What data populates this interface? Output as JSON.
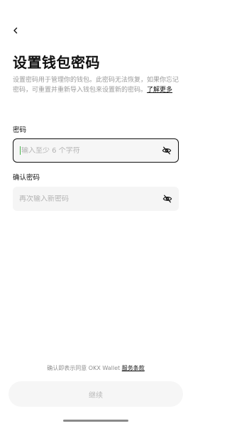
{
  "header": {
    "title": "设置钱包密码",
    "description": "设置密码用于管理你的钱包。此密码无法恢复，如果你忘记密码，可重置并重新导入钱包来设置新的密码。",
    "learn_more": "了解更多"
  },
  "form": {
    "password_label": "密码",
    "password_placeholder": "输入至少 6 个字符",
    "confirm_label": "确认密码",
    "confirm_placeholder": "再次输入新密码"
  },
  "footer": {
    "terms_prefix": "确认即表示同意 OKX Wallet ",
    "terms_link": "服务条款",
    "continue_label": "继续"
  },
  "icons": {
    "back": "chevron-left-icon",
    "visibility": "eye-off-icon"
  },
  "colors": {
    "caret": "#46b34a",
    "active_border": "#111111",
    "button_bg": "#f6f6f6"
  }
}
